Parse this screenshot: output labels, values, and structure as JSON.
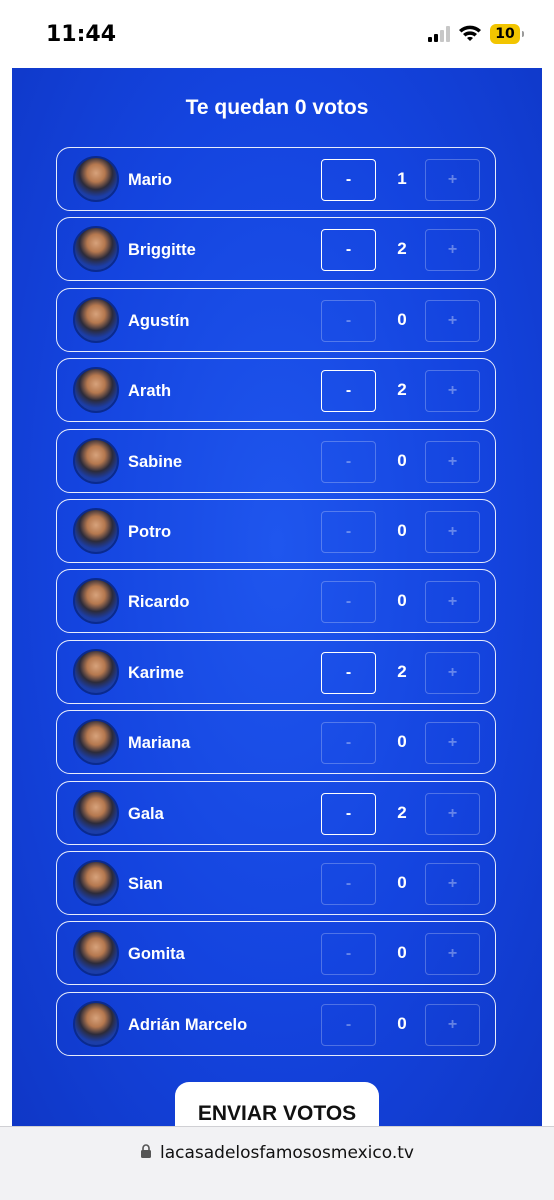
{
  "status_bar": {
    "time": "11:44",
    "battery": "10"
  },
  "header": {
    "remaining": "Te quedan 0 votos"
  },
  "buttons": {
    "minus": "-",
    "plus": "+"
  },
  "contestants": [
    {
      "name": "Mario",
      "votes": "1",
      "minus_enabled": true
    },
    {
      "name": "Briggitte",
      "votes": "2",
      "minus_enabled": true
    },
    {
      "name": "Agustín",
      "votes": "0",
      "minus_enabled": false
    },
    {
      "name": "Arath",
      "votes": "2",
      "minus_enabled": true
    },
    {
      "name": "Sabine",
      "votes": "0",
      "minus_enabled": false
    },
    {
      "name": "Potro",
      "votes": "0",
      "minus_enabled": false
    },
    {
      "name": "Ricardo",
      "votes": "0",
      "minus_enabled": false
    },
    {
      "name": "Karime",
      "votes": "2",
      "minus_enabled": true
    },
    {
      "name": "Mariana",
      "votes": "0",
      "minus_enabled": false
    },
    {
      "name": "Gala",
      "votes": "2",
      "minus_enabled": true
    },
    {
      "name": "Sian",
      "votes": "0",
      "minus_enabled": false
    },
    {
      "name": "Gomita",
      "votes": "0",
      "minus_enabled": false
    },
    {
      "name": "Adrián Marcelo",
      "votes": "0",
      "minus_enabled": false
    }
  ],
  "submit": {
    "label": "ENVIAR VOTOS"
  },
  "browser": {
    "url": "lacasadelosfamososmexico.tv"
  },
  "colors": {
    "background": "#1444df",
    "accent": "#ffffff"
  },
  "icons": {
    "lock": "lock-icon",
    "wifi": "wifi-icon",
    "signal": "signal-icon"
  }
}
